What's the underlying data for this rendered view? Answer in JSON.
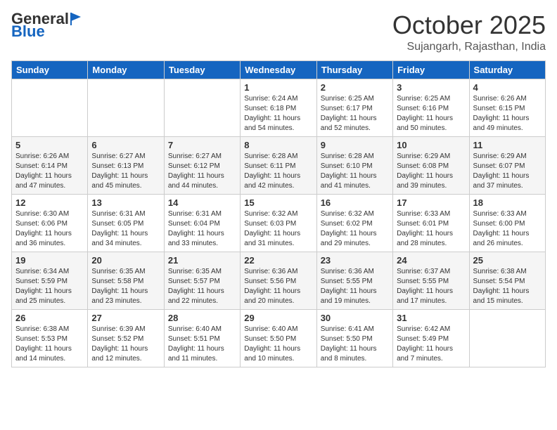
{
  "header": {
    "logo_general": "General",
    "logo_blue": "Blue",
    "month": "October 2025",
    "location": "Sujangarh, Rajasthan, India"
  },
  "weekdays": [
    "Sunday",
    "Monday",
    "Tuesday",
    "Wednesday",
    "Thursday",
    "Friday",
    "Saturday"
  ],
  "weeks": [
    [
      {
        "day": "",
        "info": ""
      },
      {
        "day": "",
        "info": ""
      },
      {
        "day": "",
        "info": ""
      },
      {
        "day": "1",
        "info": "Sunrise: 6:24 AM\nSunset: 6:18 PM\nDaylight: 11 hours\nand 54 minutes."
      },
      {
        "day": "2",
        "info": "Sunrise: 6:25 AM\nSunset: 6:17 PM\nDaylight: 11 hours\nand 52 minutes."
      },
      {
        "day": "3",
        "info": "Sunrise: 6:25 AM\nSunset: 6:16 PM\nDaylight: 11 hours\nand 50 minutes."
      },
      {
        "day": "4",
        "info": "Sunrise: 6:26 AM\nSunset: 6:15 PM\nDaylight: 11 hours\nand 49 minutes."
      }
    ],
    [
      {
        "day": "5",
        "info": "Sunrise: 6:26 AM\nSunset: 6:14 PM\nDaylight: 11 hours\nand 47 minutes."
      },
      {
        "day": "6",
        "info": "Sunrise: 6:27 AM\nSunset: 6:13 PM\nDaylight: 11 hours\nand 45 minutes."
      },
      {
        "day": "7",
        "info": "Sunrise: 6:27 AM\nSunset: 6:12 PM\nDaylight: 11 hours\nand 44 minutes."
      },
      {
        "day": "8",
        "info": "Sunrise: 6:28 AM\nSunset: 6:11 PM\nDaylight: 11 hours\nand 42 minutes."
      },
      {
        "day": "9",
        "info": "Sunrise: 6:28 AM\nSunset: 6:10 PM\nDaylight: 11 hours\nand 41 minutes."
      },
      {
        "day": "10",
        "info": "Sunrise: 6:29 AM\nSunset: 6:08 PM\nDaylight: 11 hours\nand 39 minutes."
      },
      {
        "day": "11",
        "info": "Sunrise: 6:29 AM\nSunset: 6:07 PM\nDaylight: 11 hours\nand 37 minutes."
      }
    ],
    [
      {
        "day": "12",
        "info": "Sunrise: 6:30 AM\nSunset: 6:06 PM\nDaylight: 11 hours\nand 36 minutes."
      },
      {
        "day": "13",
        "info": "Sunrise: 6:31 AM\nSunset: 6:05 PM\nDaylight: 11 hours\nand 34 minutes."
      },
      {
        "day": "14",
        "info": "Sunrise: 6:31 AM\nSunset: 6:04 PM\nDaylight: 11 hours\nand 33 minutes."
      },
      {
        "day": "15",
        "info": "Sunrise: 6:32 AM\nSunset: 6:03 PM\nDaylight: 11 hours\nand 31 minutes."
      },
      {
        "day": "16",
        "info": "Sunrise: 6:32 AM\nSunset: 6:02 PM\nDaylight: 11 hours\nand 29 minutes."
      },
      {
        "day": "17",
        "info": "Sunrise: 6:33 AM\nSunset: 6:01 PM\nDaylight: 11 hours\nand 28 minutes."
      },
      {
        "day": "18",
        "info": "Sunrise: 6:33 AM\nSunset: 6:00 PM\nDaylight: 11 hours\nand 26 minutes."
      }
    ],
    [
      {
        "day": "19",
        "info": "Sunrise: 6:34 AM\nSunset: 5:59 PM\nDaylight: 11 hours\nand 25 minutes."
      },
      {
        "day": "20",
        "info": "Sunrise: 6:35 AM\nSunset: 5:58 PM\nDaylight: 11 hours\nand 23 minutes."
      },
      {
        "day": "21",
        "info": "Sunrise: 6:35 AM\nSunset: 5:57 PM\nDaylight: 11 hours\nand 22 minutes."
      },
      {
        "day": "22",
        "info": "Sunrise: 6:36 AM\nSunset: 5:56 PM\nDaylight: 11 hours\nand 20 minutes."
      },
      {
        "day": "23",
        "info": "Sunrise: 6:36 AM\nSunset: 5:55 PM\nDaylight: 11 hours\nand 19 minutes."
      },
      {
        "day": "24",
        "info": "Sunrise: 6:37 AM\nSunset: 5:55 PM\nDaylight: 11 hours\nand 17 minutes."
      },
      {
        "day": "25",
        "info": "Sunrise: 6:38 AM\nSunset: 5:54 PM\nDaylight: 11 hours\nand 15 minutes."
      }
    ],
    [
      {
        "day": "26",
        "info": "Sunrise: 6:38 AM\nSunset: 5:53 PM\nDaylight: 11 hours\nand 14 minutes."
      },
      {
        "day": "27",
        "info": "Sunrise: 6:39 AM\nSunset: 5:52 PM\nDaylight: 11 hours\nand 12 minutes."
      },
      {
        "day": "28",
        "info": "Sunrise: 6:40 AM\nSunset: 5:51 PM\nDaylight: 11 hours\nand 11 minutes."
      },
      {
        "day": "29",
        "info": "Sunrise: 6:40 AM\nSunset: 5:50 PM\nDaylight: 11 hours\nand 10 minutes."
      },
      {
        "day": "30",
        "info": "Sunrise: 6:41 AM\nSunset: 5:50 PM\nDaylight: 11 hours\nand 8 minutes."
      },
      {
        "day": "31",
        "info": "Sunrise: 6:42 AM\nSunset: 5:49 PM\nDaylight: 11 hours\nand 7 minutes."
      },
      {
        "day": "",
        "info": ""
      }
    ]
  ]
}
